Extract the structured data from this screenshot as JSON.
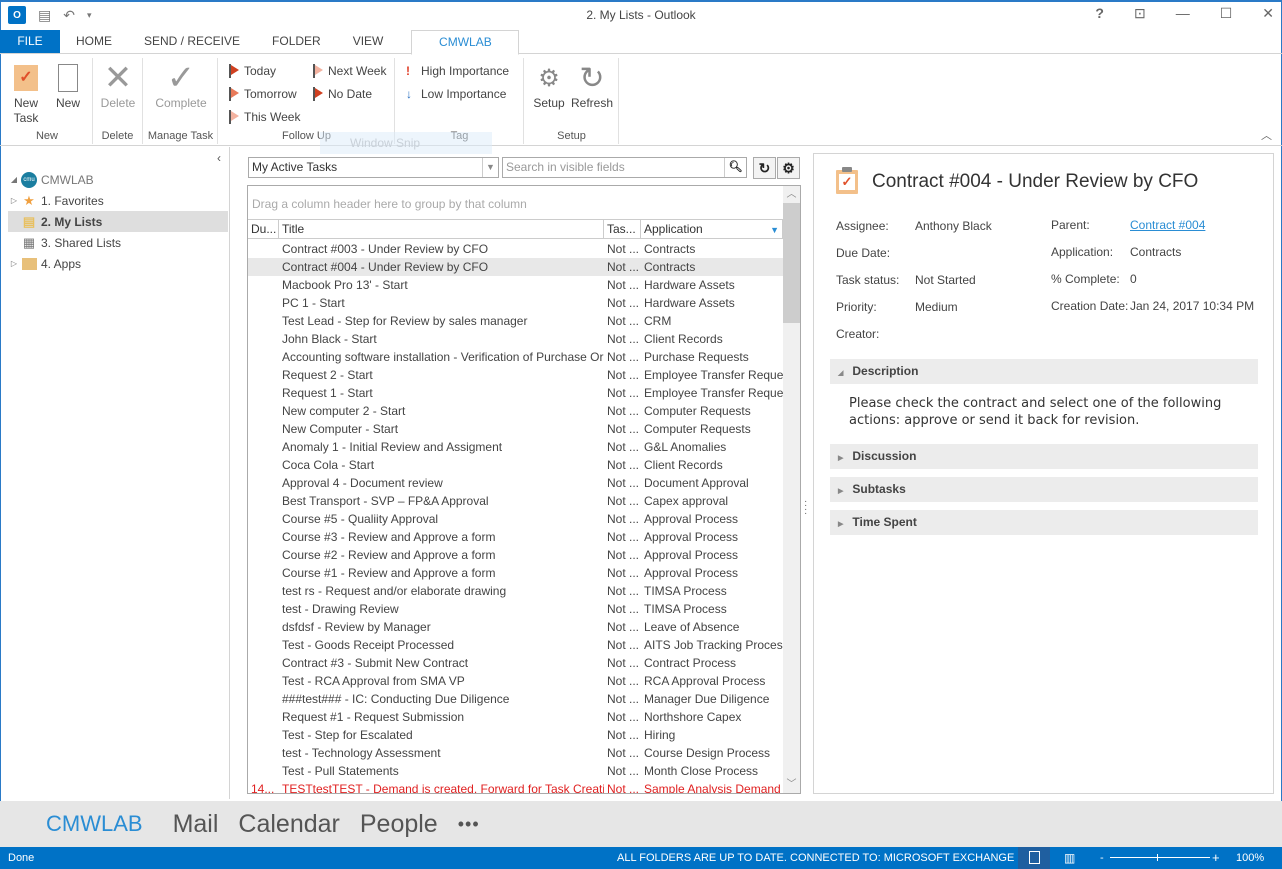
{
  "window": {
    "title": "2. My Lists - Outlook",
    "controls": [
      "help-icon",
      "ribbon-display-icon",
      "minimize-icon",
      "maximize-icon",
      "close-icon"
    ]
  },
  "ribbon_tabs": [
    {
      "label": "FILE"
    },
    {
      "label": "HOME"
    },
    {
      "label": "SEND / RECEIVE"
    },
    {
      "label": "FOLDER"
    },
    {
      "label": "VIEW"
    },
    {
      "label": "CMWLAB",
      "active": true
    }
  ],
  "ribbon": {
    "groups": {
      "new": "New",
      "delete": "Delete",
      "manage": "Manage Task",
      "followup": "Follow Up",
      "tag": "Tag",
      "setup": "Setup"
    },
    "new_task": "New Task",
    "new": "New",
    "delete": "Delete",
    "complete": "Complete",
    "today": "Today",
    "tomorrow": "Tomorrow",
    "this_week": "This Week",
    "next_week": "Next Week",
    "no_date": "No Date",
    "high_importance": "High Importance",
    "low_importance": "Low Importance",
    "setup": "Setup",
    "refresh": "Refresh",
    "snip_overlay": "Window Snip"
  },
  "nav": {
    "root": "CMWLAB",
    "items": [
      {
        "label": "1. Favorites"
      },
      {
        "label": "2. My Lists",
        "selected": true
      },
      {
        "label": "3. Shared Lists"
      },
      {
        "label": "4. Apps"
      }
    ]
  },
  "list": {
    "view": "My Active Tasks",
    "search_placeholder": "Search in visible fields",
    "group_hint": "Drag a column header here to group by that column",
    "columns": [
      "Du...",
      "Title",
      "Tas...",
      "Application"
    ],
    "rows": [
      {
        "due": "",
        "title": "Contract #003 - Under Review by CFO",
        "status": "Not ...",
        "app": "Contracts"
      },
      {
        "due": "",
        "title": "Contract #004 - Under Review by CFO",
        "status": "Not ...",
        "app": "Contracts",
        "selected": true
      },
      {
        "due": "",
        "title": "Macbook Pro 13' - Start",
        "status": "Not ...",
        "app": "Hardware Assets"
      },
      {
        "due": "",
        "title": "PC 1 - Start",
        "status": "Not ...",
        "app": "Hardware Assets"
      },
      {
        "due": "",
        "title": "Test Lead - Step for Review by sales manager",
        "status": "Not ...",
        "app": "CRM"
      },
      {
        "due": "",
        "title": "John Black - Start",
        "status": "Not ...",
        "app": "Client Records"
      },
      {
        "due": "",
        "title": "Accounting software installation - Verification of Purchase Order",
        "status": "Not ...",
        "app": "Purchase Requests"
      },
      {
        "due": "",
        "title": "Request 2 - Start",
        "status": "Not ...",
        "app": "Employee Transfer Reque..."
      },
      {
        "due": "",
        "title": "Request 1 - Start",
        "status": "Not ...",
        "app": "Employee Transfer Reque..."
      },
      {
        "due": "",
        "title": "New computer 2 - Start",
        "status": "Not ...",
        "app": "Computer Requests"
      },
      {
        "due": "",
        "title": "New Computer - Start",
        "status": "Not ...",
        "app": "Computer Requests"
      },
      {
        "due": "",
        "title": "Anomaly 1 - Initial Review and Assigment",
        "status": "Not ...",
        "app": "G&L Anomalies"
      },
      {
        "due": "",
        "title": "Coca Cola - Start",
        "status": "Not ...",
        "app": "Client Records"
      },
      {
        "due": "",
        "title": "Approval 4 - Document review",
        "status": "Not ...",
        "app": "Document Approval"
      },
      {
        "due": "",
        "title": "Best Transport - SVP – FP&A Approval",
        "status": "Not ...",
        "app": "Capex approval"
      },
      {
        "due": "",
        "title": "Course #5 - Qualiity Approval",
        "status": "Not ...",
        "app": "Approval Process"
      },
      {
        "due": "",
        "title": "Course #3 - Review and Approve a form",
        "status": "Not ...",
        "app": "Approval Process"
      },
      {
        "due": "",
        "title": "Course #2 - Review and Approve a form",
        "status": "Not ...",
        "app": "Approval Process"
      },
      {
        "due": "",
        "title": "Course #1 - Review and Approve a form",
        "status": "Not ...",
        "app": "Approval Process"
      },
      {
        "due": "",
        "title": "test rs - Request and/or elaborate drawing",
        "status": "Not ...",
        "app": "TIMSA Process"
      },
      {
        "due": "",
        "title": "test - Drawing Review",
        "status": "Not ...",
        "app": "TIMSA Process"
      },
      {
        "due": "",
        "title": "dsfdsf - Review by Manager",
        "status": "Not ...",
        "app": "Leave of Absence"
      },
      {
        "due": "",
        "title": "Test - Goods Receipt Processed",
        "status": "Not ...",
        "app": "AITS Job Tracking Process"
      },
      {
        "due": "",
        "title": "Contract #3 - Submit New Contract",
        "status": "Not ...",
        "app": "Contract Process"
      },
      {
        "due": "",
        "title": "Test - RCA Approval from SMA VP",
        "status": "Not ...",
        "app": "RCA Approval Process"
      },
      {
        "due": "",
        "title": "###test### - IC: Conducting Due Diligence",
        "status": "Not ...",
        "app": "Manager Due Diligence"
      },
      {
        "due": "",
        "title": "Request #1 - Request Submission",
        "status": "Not ...",
        "app": "Northshore Capex"
      },
      {
        "due": "",
        "title": "Test - Step for Escalated",
        "status": "Not ...",
        "app": "Hiring"
      },
      {
        "due": "",
        "title": "test - Technology Assessment",
        "status": "Not ...",
        "app": "Course Design Process"
      },
      {
        "due": "",
        "title": "Test - Pull Statements",
        "status": "Not ...",
        "app": "Month Close Process"
      },
      {
        "due": "14...",
        "title": "TESTtestTEST - Demand is created. Forward for Task Creation",
        "status": "Not ...",
        "app": "Sample Analysis Demand",
        "overdue": true
      }
    ]
  },
  "detail": {
    "title": "Contract #004 - Under Review by CFO",
    "fields": {
      "assignee_label": "Assignee:",
      "assignee": "Anthony Black",
      "due_label": "Due Date:",
      "due": "",
      "status_label": "Task status:",
      "status": "Not Started",
      "priority_label": "Priority:",
      "priority": "Medium",
      "creator_label": "Creator:",
      "creator": "",
      "parent_label": "Parent:",
      "parent": "Contract #004",
      "application_label": "Application:",
      "application": "Contracts",
      "complete_label": "% Complete:",
      "complete": "0",
      "created_label": "Creation Date:",
      "created": "Jan 24, 2017 10:34 PM"
    },
    "sections": {
      "description": "Description",
      "discussion": "Discussion",
      "subtasks": "Subtasks",
      "time_spent": "Time Spent"
    },
    "description_text": "Please check the contract and select one of the following actions: approve or send it back for revision."
  },
  "peek_bar": {
    "items": [
      "CMWLAB",
      "Mail",
      "Calendar",
      "People"
    ],
    "more": "•••"
  },
  "status_bar": {
    "left": "Done",
    "sync": "ALL FOLDERS ARE UP TO DATE.",
    "connection": "CONNECTED TO: MICROSOFT EXCHANGE",
    "zoom": "100%"
  },
  "colors": {
    "accent": "#0072c6",
    "tab_active": "#2a8dd4",
    "overdue": "#e02020",
    "flag": "#d04020"
  }
}
